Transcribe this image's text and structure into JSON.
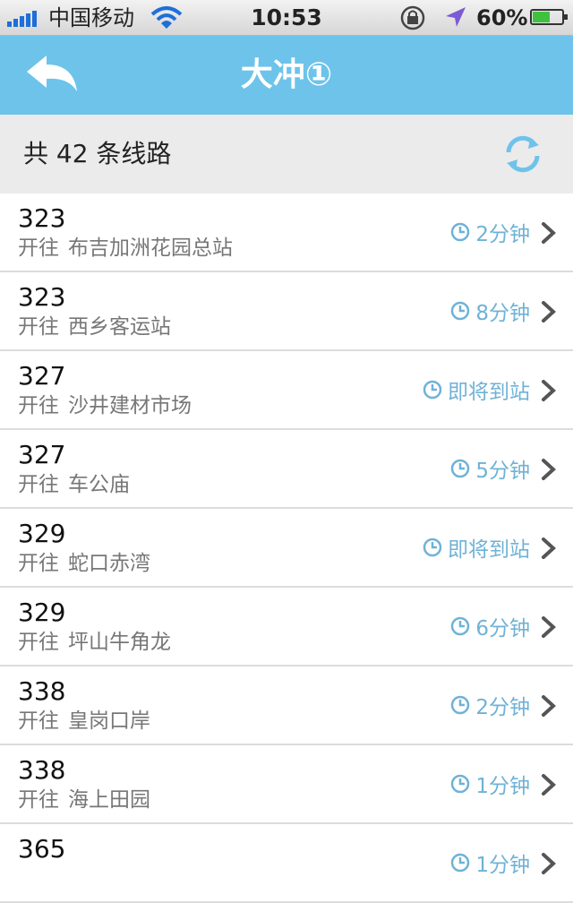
{
  "status": {
    "carrier": "中国移动",
    "time": "10:53",
    "battery": "60%",
    "battery_level": 0.6
  },
  "nav": {
    "title": "大冲①"
  },
  "summary": {
    "text": "共 42 条线路"
  },
  "list": {
    "prefix": "开往",
    "routes": [
      {
        "number": "323",
        "destination": "布吉加洲花园总站",
        "eta": "2分钟"
      },
      {
        "number": "323",
        "destination": "西乡客运站",
        "eta": "8分钟"
      },
      {
        "number": "327",
        "destination": "沙井建材市场",
        "eta": "即将到站"
      },
      {
        "number": "327",
        "destination": "车公庙",
        "eta": "5分钟"
      },
      {
        "number": "329",
        "destination": "蛇口赤湾",
        "eta": "即将到站"
      },
      {
        "number": "329",
        "destination": "坪山牛角龙",
        "eta": "6分钟"
      },
      {
        "number": "338",
        "destination": "皇岗口岸",
        "eta": "2分钟"
      },
      {
        "number": "338",
        "destination": "海上田园",
        "eta": "1分钟"
      },
      {
        "number": "365",
        "destination": "",
        "eta": "1分钟"
      }
    ]
  },
  "colors": {
    "nav_bg": "#6ec3ea",
    "eta": "#6fb2d6",
    "summary_bg": "#ebebeb"
  },
  "icons": {
    "back": "back-arrow-icon",
    "refresh": "refresh-icon",
    "clock": "clock-icon",
    "chevron": "chevron-right-icon"
  }
}
